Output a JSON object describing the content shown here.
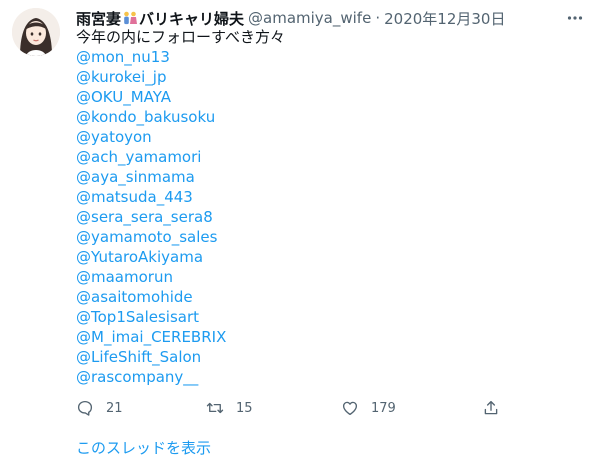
{
  "tweet": {
    "author_name": "雨宮妻",
    "author_name_suffix": "バリキャリ婦夫",
    "handle": "@amamiya_wife",
    "separator": "·",
    "date": "2020年12月30日",
    "intro": "今年の内にフォローすべき方々",
    "mentions": [
      "@mon_nu13",
      "@kurokei_jp",
      "@OKU_MAYA",
      "@kondo_bakusoku",
      "@yatoyon",
      "@ach_yamamori",
      "@aya_sinmama",
      "@matsuda_443",
      "@sera_sera_sera8",
      "@yamamoto_sales",
      "@YutaroAkiyama",
      "@maamorun",
      "@asaitomohide",
      "@Top1Salesisart",
      "@M_imai_CEREBRIX",
      "@LifeShift_Salon",
      "@rascompany__"
    ]
  },
  "actions": {
    "reply_count": "21",
    "retweet_count": "15",
    "like_count": "179"
  },
  "thread_link": "このスレッドを表示",
  "icons": [
    "more-icon",
    "reply-icon",
    "retweet-icon",
    "like-icon",
    "share-icon",
    "couple-emoji-icon"
  ],
  "colors": {
    "link": "#1d9bf0",
    "secondary": "#536471",
    "text": "#0f1419"
  }
}
